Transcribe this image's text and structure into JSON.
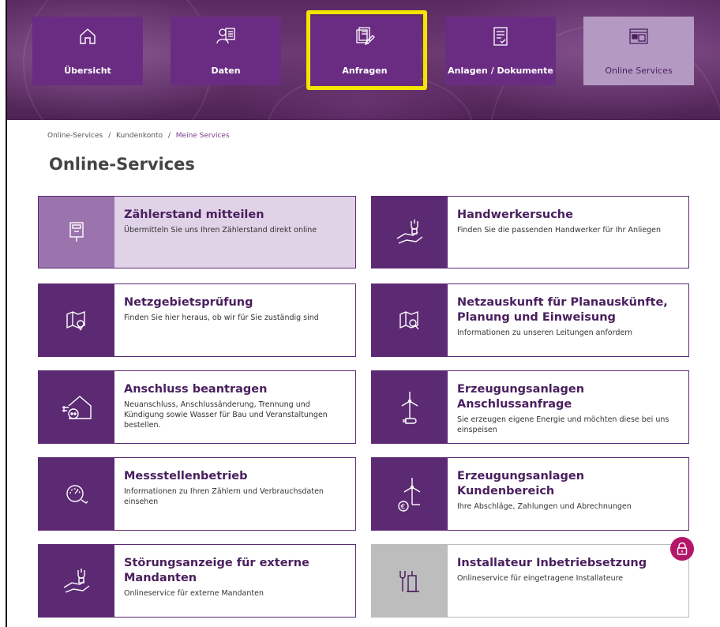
{
  "nav": {
    "tiles": [
      {
        "label": "Übersicht",
        "icon": "home-icon"
      },
      {
        "label": "Daten",
        "icon": "user-card-icon"
      },
      {
        "label": "Anfragen",
        "icon": "request-edit-icon"
      },
      {
        "label": "Anlagen / Dokumente",
        "icon": "document-icon"
      },
      {
        "label": "Online Services",
        "icon": "browser-window-icon"
      }
    ],
    "highlight_color": "#f5e400"
  },
  "breadcrumb": {
    "item1": "Online-Services",
    "sep": "/",
    "item2": "Kundenkonto",
    "current": "Meine Services"
  },
  "page_title": "Online-Services",
  "cards": [
    {
      "title": "Zählerstand mitteilen",
      "desc": "Übermitteln Sie uns Ihren Zählerstand direkt online",
      "icon": "meter-icon"
    },
    {
      "title": "Handwerkersuche",
      "desc": "Finden Sie die passenden Handwerker für Ihr Anliegen",
      "icon": "hand-tool-icon"
    },
    {
      "title": "Netzgebietsprüfung",
      "desc": "Finden Sie hier heraus, ob wir für Sie zuständig sind",
      "icon": "map-pin-icon"
    },
    {
      "title": "Netzauskunft für Planauskünfte, Planung und Einweisung",
      "desc": "Informationen zu unseren Leitungen anfordern",
      "icon": "map-search-icon"
    },
    {
      "title": "Anschluss beantragen",
      "desc": "Neuanschluss, Anschlussänderung, Trennung und Kündigung sowie Wasser für Bau und Veranstaltungen bestellen.",
      "icon": "house-plug-icon"
    },
    {
      "title": "Erzeugungsanlagen Anschlussanfrage",
      "desc": "Sie erzeugen eigene Energie und möchten diese bei uns einspeisen",
      "icon": "wind-turbine-plug-icon"
    },
    {
      "title": "Messstellenbetrieb",
      "desc": "Informationen zu Ihren Zählern und Verbrauchsdaten einsehen",
      "icon": "gauge-icon"
    },
    {
      "title": "Erzeugungsanlagen Kundenbereich",
      "desc": "Ihre Abschläge, Zahlungen und Abrechnungen",
      "icon": "wind-turbine-euro-icon"
    },
    {
      "title": "Störungsanzeige für externe Mandanten",
      "desc": "Onlineservice für externe Mandanten",
      "icon": "hand-tool-icon"
    },
    {
      "title": "Installateur Inbetriebsetzung",
      "desc": "Onlineservice für eingetragene Installateure",
      "icon": "installer-tools-icon"
    }
  ],
  "colors": {
    "brand_purple": "#5c2a73",
    "active_card_bg": "#e0d2e7",
    "lock_badge": "#b3176a"
  },
  "lock_icon": "lock-icon"
}
